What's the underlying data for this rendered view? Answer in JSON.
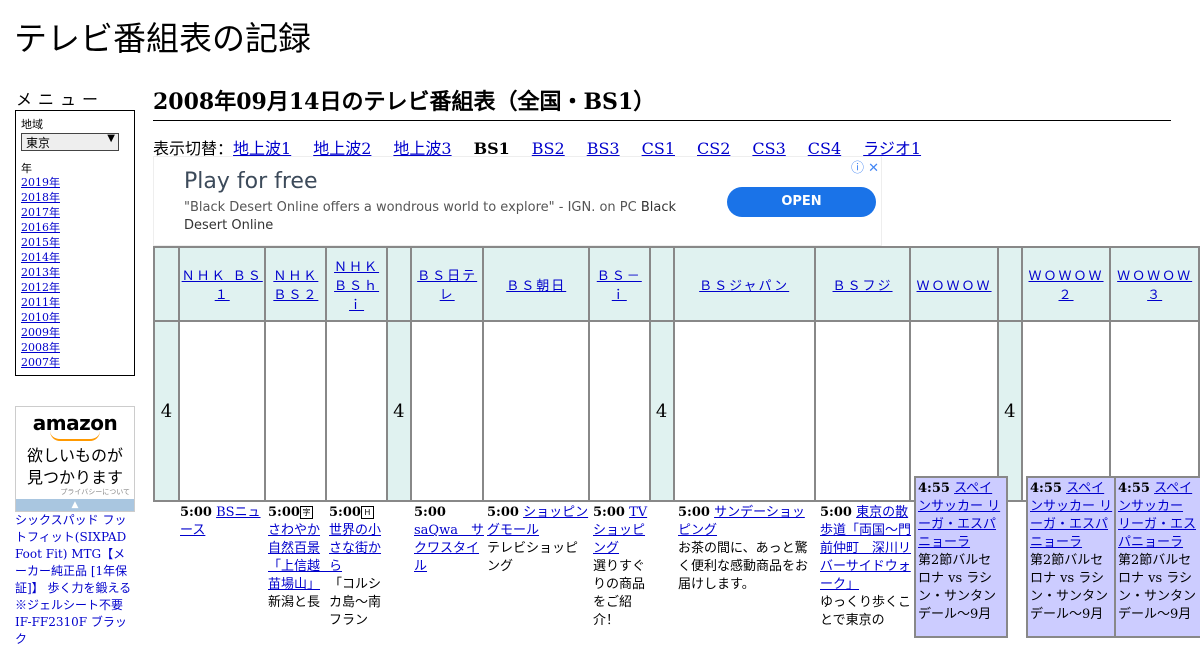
{
  "site_title": "テレビ番組表の記録",
  "menu": {
    "heading": "メニュー",
    "region_label": "地域",
    "region_value": "東京",
    "year_label": "年",
    "years": [
      "2019年",
      "2018年",
      "2017年",
      "2016年",
      "2015年",
      "2014年",
      "2013年",
      "2012年",
      "2011年",
      "2010年",
      "2009年",
      "2008年",
      "2007年"
    ]
  },
  "amazon": {
    "logo": "amazon",
    "copy_line1": "欲しいものが",
    "copy_line2": "見つかります",
    "privacy": "プライバシーについて",
    "bar_icon": "▲"
  },
  "product_link": "シックスパッド フットフィット(SIXPAD Foot Fit) MTG【メーカー純正品 [1年保証]】 歩く力を鍛える ※ジェルシート不要 IF-FF2310F ブラック",
  "page_title": "2008年09月14日のテレビ番組表（全国・BS1）",
  "switcher": {
    "label": "表示切替：",
    "links": [
      "地上波1",
      "地上波2",
      "地上波3"
    ],
    "current": "BS1",
    "links2": [
      "BS2",
      "BS3",
      "CS1",
      "CS2",
      "CS3",
      "CS4",
      "ラジオ1"
    ]
  },
  "ad": {
    "heading": "Play for free",
    "desc": "\"Black Desert Online offers a wondrous world to explore\" - IGN. on PC",
    "desc_brand": "Black Desert Online",
    "button": "OPEN",
    "icons": "ⓘ ✕"
  },
  "channels": [
    "ＮＨＫ ＢＳ１",
    "ＮＨＫ ＢＳ２",
    "ＮＨＫ ＢＳｈｉ",
    "ＢＳ日テレ",
    "ＢＳ朝日",
    "ＢＳ－ｉ",
    "ＢＳジャパン",
    "ＢＳフジ",
    "ＷＯＷＯＷ",
    "ＷＯＷＯＷ２",
    "ＷＯＷＯＷ３"
  ],
  "hour": "4",
  "programs": {
    "nhkbs1": {
      "time": "5:00",
      "title": "BSニュース"
    },
    "nhkbs2": {
      "time": "5:00",
      "mark": "字",
      "title": "さわやか自然百景「上信越　苗場山」",
      "desc": "新潟と長"
    },
    "nhkbshi": {
      "time": "5:00",
      "mark": "H",
      "title": "世界の小さな街から",
      "desc": "「コルシカ島～南フラン"
    },
    "bsntv": {
      "time": "5:00",
      "title": "saQwa　サクワスタイル"
    },
    "bsasahi": {
      "time": "5:00",
      "title": "ショッピングモール",
      "desc": "テレビショッピング"
    },
    "bsi": {
      "time": "5:00",
      "title": "TVショッピング",
      "desc": "選りすぐりの商品をご紹介！"
    },
    "bsjapan": {
      "time": "5:00",
      "title": "サンデーショッピング",
      "desc": "お茶の間に、あっと驚く便利な感動商品をお届けします。"
    },
    "bsfuji": {
      "time": "5:00",
      "title": "東京の散歩道「両国～門前仲町　深川リバーサイドウォーク」",
      "desc": "ゆっくり歩くことで東京の"
    },
    "wowow": {
      "time": "4:55",
      "title": "スペインサッカー リーガ・エスパニョーラ",
      "desc": "第2節バルセロナ vs ラシン・サンタンデール～9月"
    },
    "wowow2": {
      "time": "4:55",
      "title": "スペインサッカー リーガ・エスパニョーラ",
      "desc": "第2節バルセロナ vs ラシン・サンタンデール～9月"
    },
    "wowow3": {
      "time": "4:55",
      "title": "スペインサッカー リーガ・エスパニョーラ",
      "desc": "第2節バルセロナ vs ラシン・サンタンデール～9月"
    }
  }
}
